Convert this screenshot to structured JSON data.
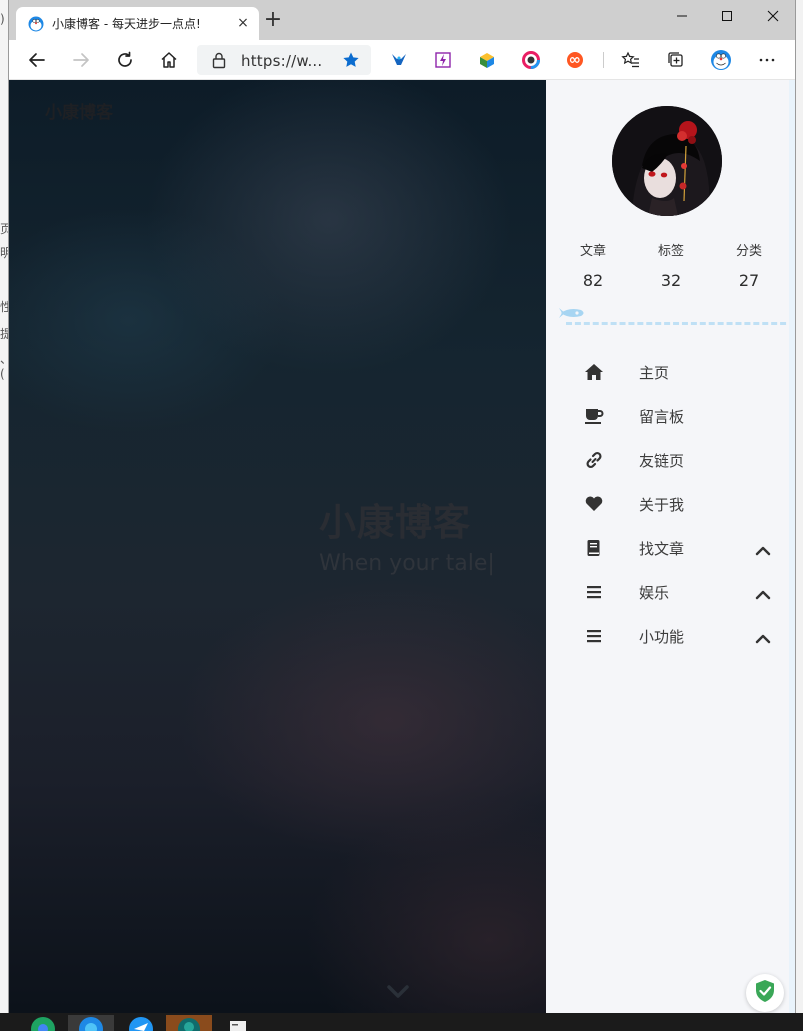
{
  "browser": {
    "tab_title": "小康博客 - 每天进步一点点!",
    "tab_close": "×",
    "new_tab": "+",
    "address": "https://w..."
  },
  "behind_window": {
    "chars": [
      ")",
      "页",
      "明",
      "性",
      "提",
      "、("
    ]
  },
  "hero": {
    "brand": "小康博客",
    "title": "小康博客",
    "subtitle": "When your tale|"
  },
  "sidebar": {
    "stats": [
      {
        "label": "文章",
        "value": "82"
      },
      {
        "label": "标签",
        "value": "32"
      },
      {
        "label": "分类",
        "value": "27"
      }
    ],
    "menu": [
      {
        "label": "主页",
        "icon": "home-icon",
        "expandable": false
      },
      {
        "label": "留言板",
        "icon": "coffee-icon",
        "expandable": false
      },
      {
        "label": "友链页",
        "icon": "link-icon",
        "expandable": false
      },
      {
        "label": "关于我",
        "icon": "heart-icon",
        "expandable": false
      },
      {
        "label": "找文章",
        "icon": "book-icon",
        "expandable": true
      },
      {
        "label": "娱乐",
        "icon": "list-icon",
        "expandable": true
      },
      {
        "label": "小功能",
        "icon": "list-icon",
        "expandable": true
      }
    ]
  },
  "colors": {
    "titlebar": "#cfcfcf",
    "accent_blue": "#0b6ccf",
    "sidebar_bg": "#f5f6f9",
    "divider": "#bfe0f5",
    "shield_green": "#3aa757"
  }
}
